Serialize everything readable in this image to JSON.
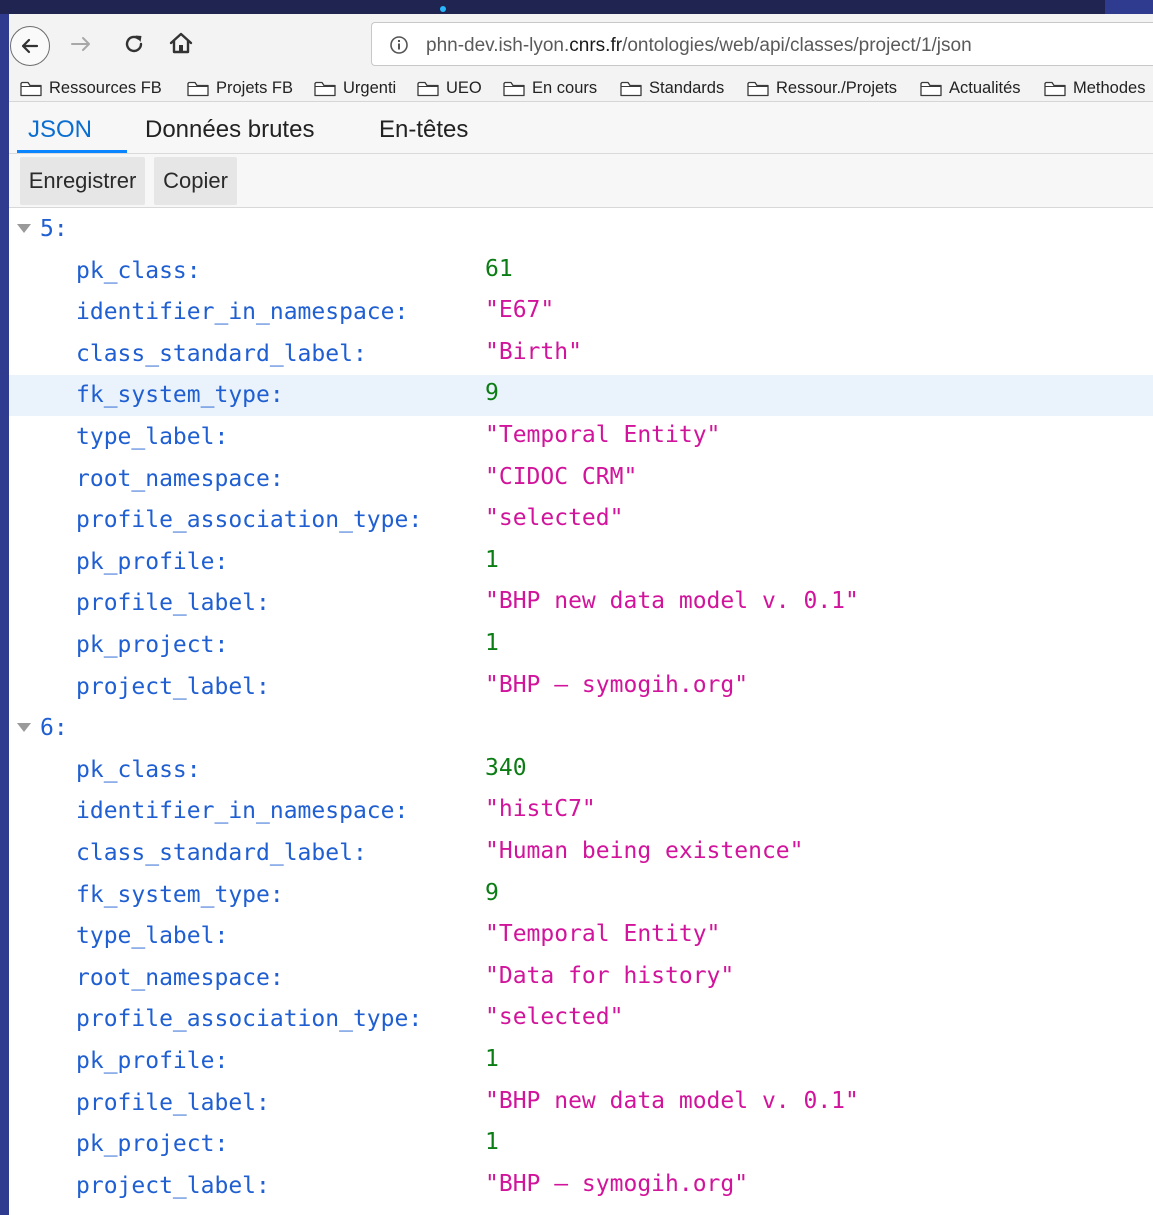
{
  "browser": {
    "url_prefix": "phn-dev.ish-lyon.",
    "url_domain": "cnrs.fr",
    "url_path": "/ontologies/web/api/classes/project/1/json"
  },
  "bookmarks": [
    {
      "label": "Ressources FB",
      "icon": "folder-icon"
    },
    {
      "label": "Projets FB",
      "icon": "folder-icon"
    },
    {
      "label": "Urgenti",
      "icon": "folder-icon"
    },
    {
      "label": "UEO",
      "icon": "folder-icon"
    },
    {
      "label": "En cours",
      "icon": "folder-icon"
    },
    {
      "label": "Standards",
      "icon": "folder-icon"
    },
    {
      "label": "Ressour./Projets",
      "icon": "folder-icon"
    },
    {
      "label": "Actualités",
      "icon": "folder-icon"
    },
    {
      "label": "Methodes",
      "icon": "folder-icon"
    }
  ],
  "tabs": [
    {
      "label": "JSON",
      "active": true
    },
    {
      "label": "Données brutes"
    },
    {
      "label": "En-têtes"
    }
  ],
  "toolbar": {
    "save_label": "Enregistrer",
    "copy_label": "Copier"
  },
  "json_view": {
    "groups": [
      {
        "index": "5:",
        "entries": [
          {
            "key": "pk_class:",
            "value": "61",
            "type": "number"
          },
          {
            "key": "identifier_in_namespace:",
            "value": "\"E67\"",
            "type": "string"
          },
          {
            "key": "class_standard_label:",
            "value": "\"Birth\"",
            "type": "string"
          },
          {
            "key": "fk_system_type:",
            "value": "9",
            "type": "number",
            "highlighted": true
          },
          {
            "key": "type_label:",
            "value": "\"Temporal Entity\"",
            "type": "string"
          },
          {
            "key": "root_namespace:",
            "value": "\"CIDOC CRM\"",
            "type": "string"
          },
          {
            "key": "profile_association_type:",
            "value": "\"selected\"",
            "type": "string"
          },
          {
            "key": "pk_profile:",
            "value": "1",
            "type": "number"
          },
          {
            "key": "profile_label:",
            "value": "\"BHP new data model v. 0.1\"",
            "type": "string"
          },
          {
            "key": "pk_project:",
            "value": "1",
            "type": "number"
          },
          {
            "key": "project_label:",
            "value": "\"BHP – symogih.org\"",
            "type": "string"
          }
        ]
      },
      {
        "index": "6:",
        "entries": [
          {
            "key": "pk_class:",
            "value": "340",
            "type": "number"
          },
          {
            "key": "identifier_in_namespace:",
            "value": "\"histC7\"",
            "type": "string"
          },
          {
            "key": "class_standard_label:",
            "value": "\"Human being existence\"",
            "type": "string"
          },
          {
            "key": "fk_system_type:",
            "value": "9",
            "type": "number"
          },
          {
            "key": "type_label:",
            "value": "\"Temporal Entity\"",
            "type": "string"
          },
          {
            "key": "root_namespace:",
            "value": "\"Data for history\"",
            "type": "string"
          },
          {
            "key": "profile_association_type:",
            "value": "\"selected\"",
            "type": "string"
          },
          {
            "key": "pk_profile:",
            "value": "1",
            "type": "number"
          },
          {
            "key": "profile_label:",
            "value": "\"BHP new data model v. 0.1\"",
            "type": "string"
          },
          {
            "key": "pk_project:",
            "value": "1",
            "type": "number"
          },
          {
            "key": "project_label:",
            "value": "\"BHP – symogih.org\"",
            "type": "string"
          }
        ]
      }
    ]
  },
  "colors": {
    "key": "#1f5fd1",
    "number": "#0b7d14",
    "string": "#d1149b",
    "active_tab": "#0a6ed1"
  }
}
